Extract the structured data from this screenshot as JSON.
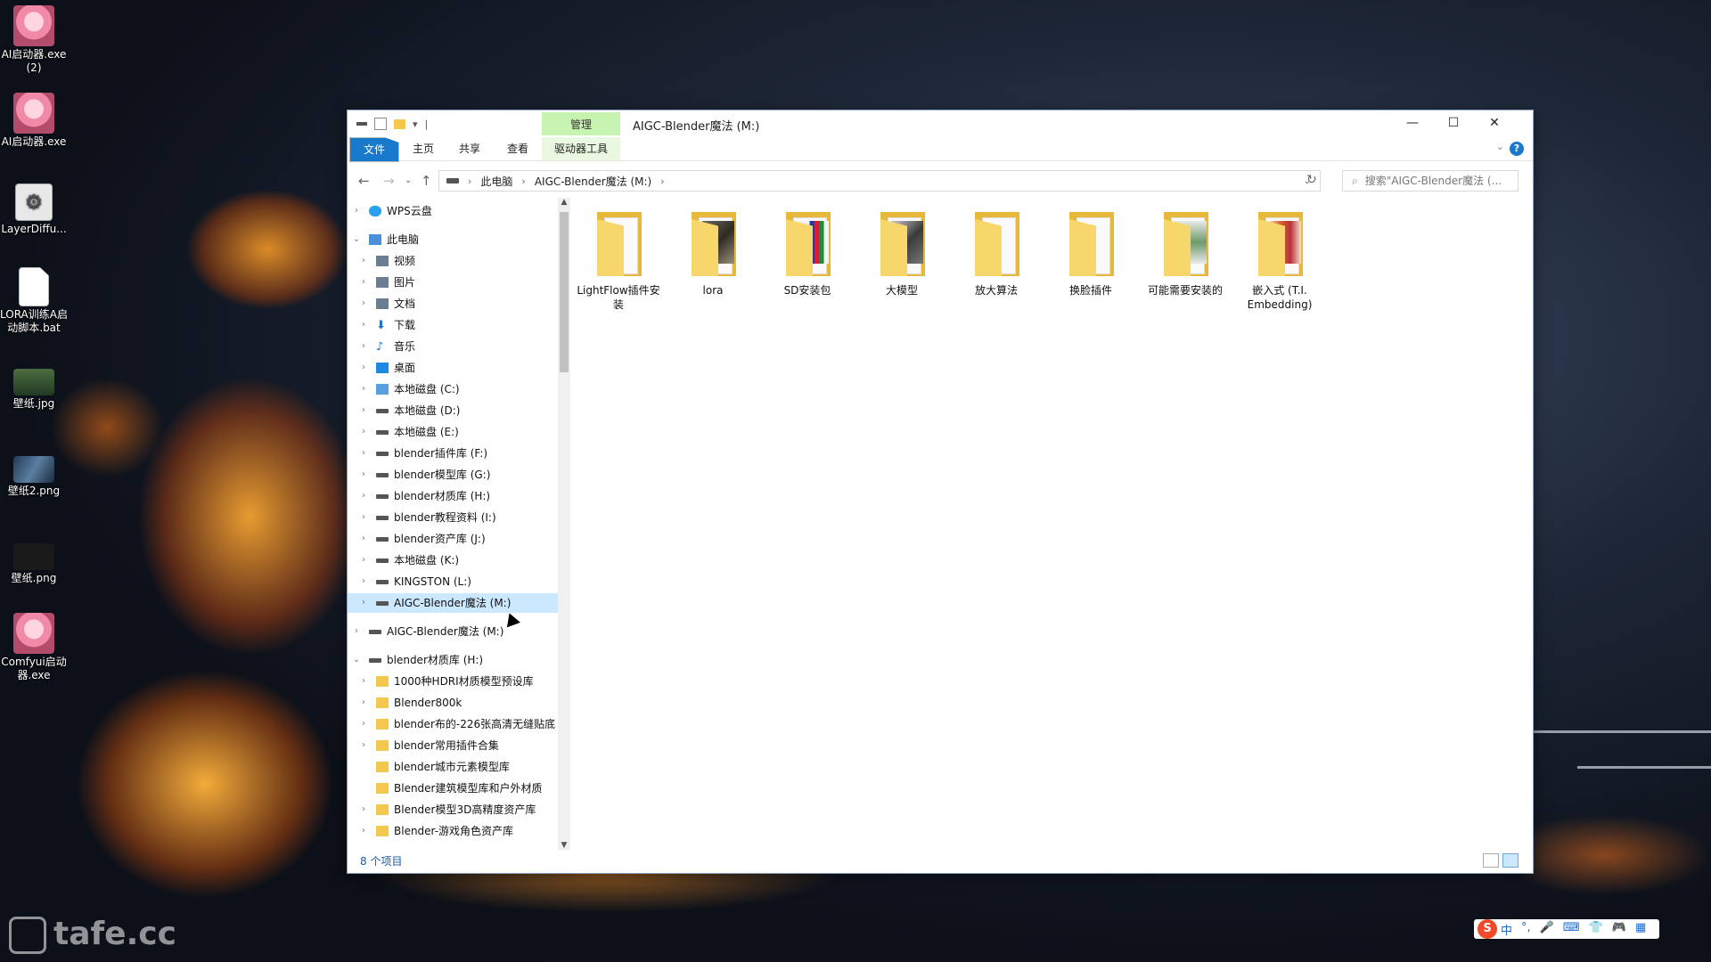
{
  "desktop": {
    "icons": [
      {
        "label": "AI启动器.exe (2)",
        "kind": "anime"
      },
      {
        "label": "AI启动器.exe",
        "kind": "anime"
      },
      {
        "label": "LayerDiffu...",
        "kind": "gears"
      },
      {
        "label": "LORA训练A启动脚本.bat",
        "kind": "file"
      },
      {
        "label": "壁纸.jpg",
        "kind": "photo1"
      },
      {
        "label": "壁纸2.png",
        "kind": "photo2"
      },
      {
        "label": "壁纸.png",
        "kind": "photo3"
      },
      {
        "label": "Comfyui启动器.exe",
        "kind": "anime"
      }
    ],
    "watermark": "tafe.cc",
    "ime": {
      "logo": "S",
      "items": [
        "中",
        "°,",
        "🎤",
        "⌨",
        "👕",
        "🎮",
        "▦"
      ]
    }
  },
  "window": {
    "title": "AIGC-Blender魔法 (M:)",
    "manage_tab": "管理",
    "ribbon_tabs": [
      "文件",
      "主页",
      "共享",
      "查看",
      "驱动器工具"
    ],
    "help": "?",
    "controls": {
      "minimize": "—",
      "maximize": "☐",
      "close": "✕"
    },
    "address": {
      "segments": [
        "此电脑",
        "AIGC-Blender魔法 (M:)"
      ]
    },
    "search_placeholder": "搜索\"AIGC-Blender魔法 (...",
    "nav_tree": [
      {
        "label": "WPS云盘",
        "icon": "cloud",
        "level": 0,
        "arrow": "›"
      },
      {
        "label": "此电脑",
        "icon": "pc",
        "level": 0,
        "arrow": "⌄"
      },
      {
        "label": "视频",
        "icon": "video",
        "level": 1,
        "arrow": "›"
      },
      {
        "label": "图片",
        "icon": "pic",
        "level": 1,
        "arrow": "›"
      },
      {
        "label": "文档",
        "icon": "doc",
        "level": 1,
        "arrow": "›"
      },
      {
        "label": "下载",
        "icon": "dl",
        "level": 1,
        "arrow": "›"
      },
      {
        "label": "音乐",
        "icon": "music",
        "level": 1,
        "arrow": "›"
      },
      {
        "label": "桌面",
        "icon": "desk",
        "level": 1,
        "arrow": "›"
      },
      {
        "label": "本地磁盘 (C:)",
        "icon": "sys",
        "level": 1,
        "arrow": "›"
      },
      {
        "label": "本地磁盘 (D:)",
        "icon": "drive",
        "level": 1,
        "arrow": "›"
      },
      {
        "label": "本地磁盘 (E:)",
        "icon": "drive",
        "level": 1,
        "arrow": "›"
      },
      {
        "label": "blender插件库 (F:)",
        "icon": "drive",
        "level": 1,
        "arrow": "›"
      },
      {
        "label": "blender模型库 (G:)",
        "icon": "drive",
        "level": 1,
        "arrow": "›"
      },
      {
        "label": "blender材质库 (H:)",
        "icon": "drive",
        "level": 1,
        "arrow": "›"
      },
      {
        "label": "blender教程资料 (I:)",
        "icon": "drive",
        "level": 1,
        "arrow": "›"
      },
      {
        "label": "blender资产库 (J:)",
        "icon": "drive",
        "level": 1,
        "arrow": "›"
      },
      {
        "label": "本地磁盘 (K:)",
        "icon": "drive",
        "level": 1,
        "arrow": "›"
      },
      {
        "label": "KINGSTON (L:)",
        "icon": "drive",
        "level": 1,
        "arrow": "›"
      },
      {
        "label": "AIGC-Blender魔法 (M:)",
        "icon": "drive",
        "level": 1,
        "arrow": "›",
        "selected": true
      },
      {
        "label": "AIGC-Blender魔法 (M:)",
        "icon": "drive",
        "level": 0,
        "arrow": "›"
      },
      {
        "label": "blender材质库 (H:)",
        "icon": "drive",
        "level": 0,
        "arrow": "⌄"
      },
      {
        "label": "1000种HDRI材质模型预设库",
        "icon": "folder",
        "level": 1,
        "arrow": "›"
      },
      {
        "label": "Blender800k",
        "icon": "folder",
        "level": 1,
        "arrow": "›"
      },
      {
        "label": "blender布的-226张高清无缝贴底",
        "icon": "folder",
        "level": 1,
        "arrow": "›"
      },
      {
        "label": "blender常用插件合集",
        "icon": "folder",
        "level": 1,
        "arrow": "›"
      },
      {
        "label": "blender城市元素模型库",
        "icon": "folder",
        "level": 1,
        "arrow": ""
      },
      {
        "label": "Blender建筑模型库和户外材质",
        "icon": "folder",
        "level": 1,
        "arrow": ""
      },
      {
        "label": "Blender模型3D高精度资产库",
        "icon": "folder",
        "level": 1,
        "arrow": "›"
      },
      {
        "label": "Blender-游戏角色资产库",
        "icon": "folder",
        "level": 1,
        "arrow": "›"
      }
    ],
    "folders": [
      {
        "label": "LightFlow插件安装",
        "img": ""
      },
      {
        "label": "lora",
        "img": "linear-gradient(135deg,#6f6a5c,#2f2c25,#9a8f78)"
      },
      {
        "label": "SD安装包",
        "img": "linear-gradient(90deg,#f2f2f2 0 40%,#1a3fa6 40% 55%,#d1203a 55% 70%,#1c8c3c 70% 85%,#f2f2f2 85%)"
      },
      {
        "label": "大模型",
        "img": "linear-gradient(135deg,#ccc,#3a3a3a,#777)"
      },
      {
        "label": "放大算法",
        "img": ""
      },
      {
        "label": "换脸插件",
        "img": ""
      },
      {
        "label": "可能需要安装的",
        "img": "linear-gradient(#e9e9e9,#6f9a6a,#e9e9e9)"
      },
      {
        "label": "嵌入式 (T.I. Embedding)",
        "img": "linear-gradient(90deg,#f2e0c8,#d96a2e,#b8323a,#f2e0c8)"
      }
    ],
    "status": "8 个项目"
  }
}
